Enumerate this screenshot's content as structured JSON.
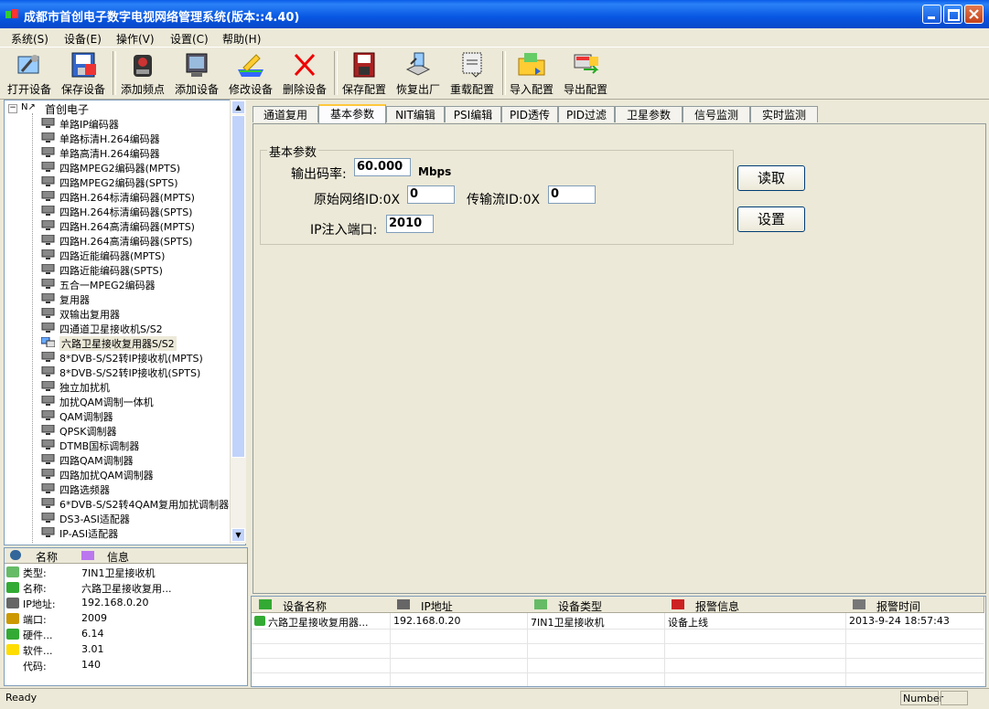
{
  "window": {
    "title": "成都市首创电子数字电视网络管理系统(版本::4.40)"
  },
  "menu": [
    "系统(S)",
    "设备(E)",
    "操作(V)",
    "设置(C)",
    "帮助(H)"
  ],
  "toolbar": [
    {
      "label": "打开设备",
      "icon": "open-device-icon"
    },
    {
      "label": "保存设备",
      "icon": "save-device-icon"
    },
    {
      "label": "添加频点",
      "icon": "add-frequency-icon"
    },
    {
      "label": "添加设备",
      "icon": "add-device-icon"
    },
    {
      "label": "修改设备",
      "icon": "edit-device-icon"
    },
    {
      "label": "删除设备",
      "icon": "delete-device-icon"
    },
    {
      "label": "保存配置",
      "icon": "save-config-icon"
    },
    {
      "label": "恢复出厂",
      "icon": "factory-reset-icon"
    },
    {
      "label": "重载配置",
      "icon": "reload-config-icon"
    },
    {
      "label": "导入配置",
      "icon": "import-config-icon"
    },
    {
      "label": "导出配置",
      "icon": "export-config-icon"
    }
  ],
  "tree": {
    "root": "首创电子",
    "selected_index": 15,
    "items": [
      "单路IP编码器",
      "单路标清H.264编码器",
      "单路高清H.264编码器",
      "四路MPEG2编码器(MPTS)",
      "四路MPEG2编码器(SPTS)",
      "四路H.264标清编码器(MPTS)",
      "四路H.264标清编码器(SPTS)",
      "四路H.264高清编码器(MPTS)",
      "四路H.264高清编码器(SPTS)",
      "四路近能编码器(MPTS)",
      "四路近能编码器(SPTS)",
      "五合一MPEG2编码器",
      "复用器",
      "双输出复用器",
      "四通道卫星接收机S/S2",
      "六路卫星接收复用器S/S2",
      "8*DVB-S/S2转IP接收机(MPTS)",
      "8*DVB-S/S2转IP接收机(SPTS)",
      "独立加扰机",
      "加扰QAM调制一体机",
      "QAM调制器",
      "QPSK调制器",
      "DTMB国标调制器",
      "四路QAM调制器",
      "四路加扰QAM调制器",
      "四路选频器",
      "6*DVB-S/S2转4QAM复用加扰调制器",
      "DS3-ASI适配器",
      "IP-ASI适配器"
    ]
  },
  "info": {
    "headers": {
      "name": "名称",
      "info": "信息"
    },
    "rows": [
      {
        "key": "类型:",
        "value": "7IN1卫星接收机",
        "icon": "type-icon"
      },
      {
        "key": "名称:",
        "value": "六路卫星接收复用...",
        "icon": "name-icon"
      },
      {
        "key": "IP地址:",
        "value": "192.168.0.20",
        "icon": "ip-icon"
      },
      {
        "key": "端口:",
        "value": "2009",
        "icon": "port-icon"
      },
      {
        "key": "硬件...",
        "value": "6.14",
        "icon": "hardware-icon"
      },
      {
        "key": "软件...",
        "value": "3.01",
        "icon": "software-icon"
      },
      {
        "key": "代码:",
        "value": "140",
        "icon": ""
      }
    ]
  },
  "tabs": [
    "通道复用",
    "基本参数",
    "NIT编辑",
    "PSI编辑",
    "PID透传",
    "PID过滤",
    "卫星参数",
    "信号监测",
    "实时监测"
  ],
  "active_tab": 1,
  "basic": {
    "group_title": "基本参数",
    "output_rate_label": "输出码率:",
    "output_rate_value": "60.000",
    "output_rate_unit": "Mbps",
    "network_id_label": "原始网络ID:0X",
    "network_id_value": "0",
    "ts_id_label": "传输流ID:0X",
    "ts_id_value": "0",
    "ip_port_label": "IP注入端口:",
    "ip_port_value": "2010",
    "read_button": "读取",
    "set_button": "设置"
  },
  "alarm": {
    "headers": [
      "设备名称",
      "IP地址",
      "设备类型",
      "报警信息",
      "报警时间"
    ],
    "rows": [
      {
        "device": "六路卫星接收复用器...",
        "ip": "192.168.0.20",
        "type": "7IN1卫星接收机",
        "alarm": "设备上线",
        "time": "2013-9-24 18:57:43"
      }
    ]
  },
  "status": {
    "left": "Ready",
    "number": "Number"
  }
}
